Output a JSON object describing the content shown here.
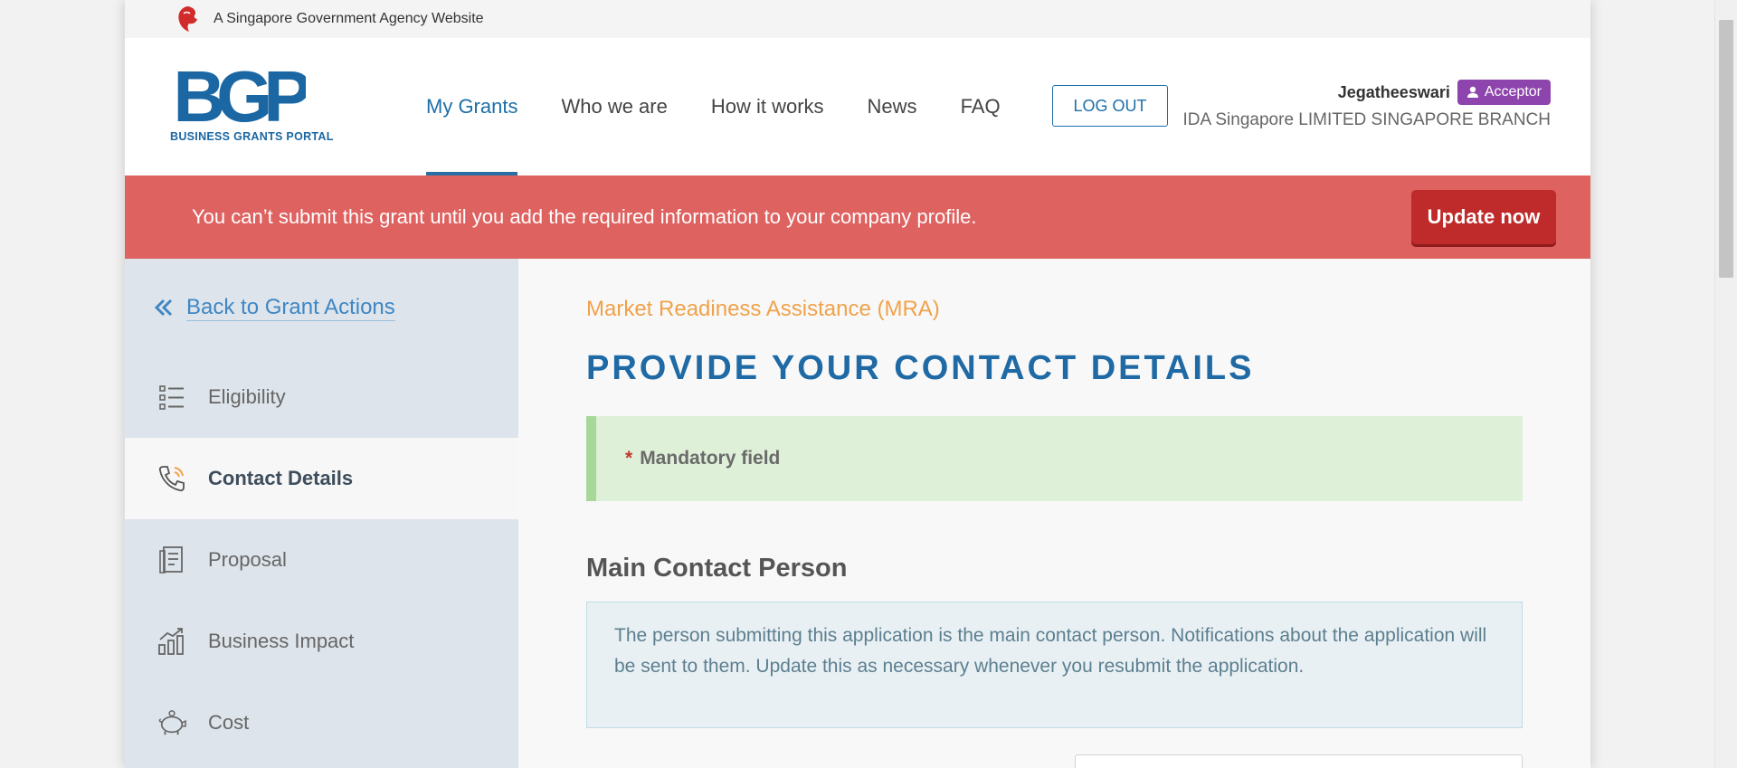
{
  "masthead": {
    "text": "A Singapore Government Agency Website"
  },
  "logo": {
    "mark": "BGP",
    "subtitle": "BUSINESS GRANTS PORTAL"
  },
  "nav": {
    "items": [
      {
        "label": "My Grants"
      },
      {
        "label": "Who we are"
      },
      {
        "label": "How it works"
      },
      {
        "label": "News"
      },
      {
        "label": "FAQ"
      }
    ],
    "active": "My Grants",
    "logout_label": "LOG OUT"
  },
  "user": {
    "name": "Jegatheeswari",
    "role": "Acceptor",
    "company": "IDA Singapore LIMITED SINGAPORE BRANCH"
  },
  "alert": {
    "message": "You can’t submit this grant until you add the required information to your company profile.",
    "button_label": "Update now"
  },
  "sidebar": {
    "back_label": "Back to Grant Actions",
    "items": [
      {
        "label": "Eligibility",
        "icon": "list-icon"
      },
      {
        "label": "Contact Details",
        "icon": "phone-icon"
      },
      {
        "label": "Proposal",
        "icon": "document-icon"
      },
      {
        "label": "Business Impact",
        "icon": "bar-chart-icon"
      },
      {
        "label": "Cost",
        "icon": "piggy-bank-icon"
      }
    ],
    "active": "Contact Details"
  },
  "main": {
    "grant_name": "Market Readiness Assistance (MRA)",
    "title": "PROVIDE YOUR CONTACT DETAILS",
    "mandatory_star": "*",
    "mandatory_text": "Mandatory field",
    "section_title": "Main Contact Person",
    "info_text": "The person submitting this application is the main contact person. Notifications about the application will be sent to them. Update this as necessary whenever you resubmit the application."
  },
  "colors": {
    "brand_blue": "#1d6fa8",
    "alert_bg": "#de6260",
    "alert_button": "#bf2a2a",
    "role_badge": "#8e44ad",
    "grant_name": "#f0a24a",
    "mandatory_bg": "#dff0d8"
  }
}
